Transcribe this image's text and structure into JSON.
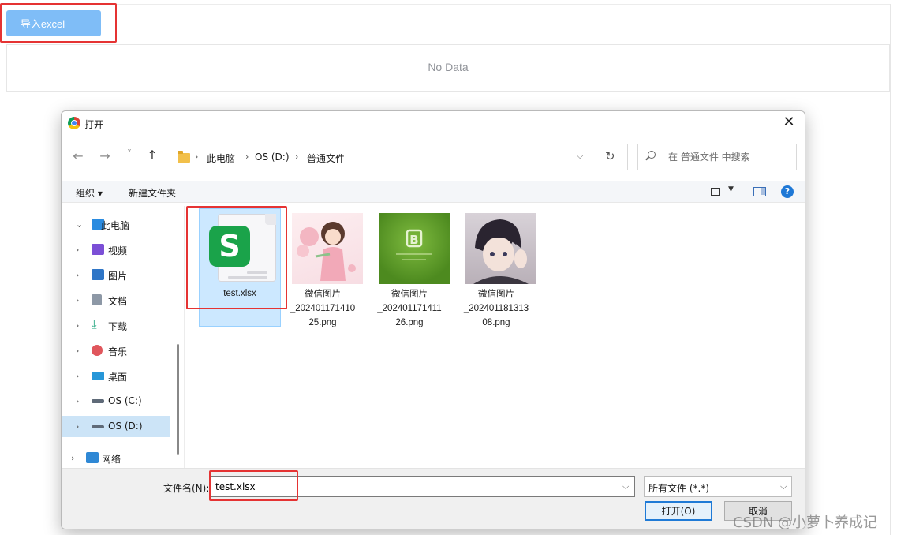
{
  "page": {
    "import_button": "导入excel",
    "empty_text": "No Data"
  },
  "dialog": {
    "title": "打开",
    "close": "✕",
    "nav": {
      "back": "←",
      "forward": "→",
      "recent": "˅",
      "up": "↑"
    },
    "breadcrumb": [
      "此电脑",
      "OS (D:)",
      "普通文件"
    ],
    "breadcrumb_sep": "›",
    "address_dropdown": "⌵",
    "refresh": "↻",
    "search_placeholder": "在 普通文件 中搜索",
    "toolbar": {
      "organize": "组织 ▾",
      "new_folder": "新建文件夹",
      "help": "?"
    },
    "sidebar": [
      {
        "label": "此电脑",
        "chevron": "⌄",
        "icon": "computer-icon",
        "color": "#2a8be0"
      },
      {
        "label": "视频",
        "chevron": "›",
        "icon": "video-icon",
        "color": "#7b4fd6"
      },
      {
        "label": "图片",
        "chevron": "›",
        "icon": "pictures-icon",
        "color": "#2f76c7"
      },
      {
        "label": "文档",
        "chevron": "›",
        "icon": "documents-icon",
        "color": "#8d98a6"
      },
      {
        "label": "下载",
        "chevron": "›",
        "icon": "download-icon",
        "color": "#1aa37a"
      },
      {
        "label": "音乐",
        "chevron": "›",
        "icon": "music-icon",
        "color": "#e0565c"
      },
      {
        "label": "桌面",
        "chevron": "›",
        "icon": "desktop-icon",
        "color": "#2696d8"
      },
      {
        "label": "OS (C:)",
        "chevron": "›",
        "icon": "drive-c-icon",
        "color": "#5f6a78"
      },
      {
        "label": "OS (D:)",
        "chevron": "›",
        "icon": "drive-d-icon",
        "color": "#5f6a78"
      },
      {
        "label": "网络",
        "chevron": "›",
        "icon": "network-icon",
        "color": "#2f88d5"
      }
    ],
    "files": [
      {
        "name": "test.xlsx",
        "type": "xlsx",
        "icon": "wps-spreadsheet-icon",
        "badge": "S"
      },
      {
        "name": "微信图片_20240117141025.png",
        "line1": "微信图片",
        "line2": "_202401171410",
        "line3": "25.png",
        "type": "image",
        "icon": "illustration-girl-thumbnail"
      },
      {
        "name": "微信图片_20240117141126.png",
        "line1": "微信图片",
        "line2": "_202401171411",
        "line3": "26.png",
        "type": "image",
        "icon": "green-b-thumbnail"
      },
      {
        "name": "微信图片_20240118131308.png",
        "line1": "微信图片",
        "line2": "_202401181313",
        "line3": "08.png",
        "type": "image",
        "icon": "anime-boy-thumbnail"
      }
    ],
    "filename_label": "文件名(N):",
    "filename_value": "test.xlsx",
    "filetype": "所有文件 (*.*)",
    "dropdown_arrow": "⌵",
    "open_button": "打开(O)",
    "cancel_button": "取消"
  },
  "watermark": "CSDN @小萝卜养成记",
  "colors": {
    "accent_red": "#e53333",
    "import_button": "#7fbdf7",
    "selection": "#cce8ff"
  }
}
